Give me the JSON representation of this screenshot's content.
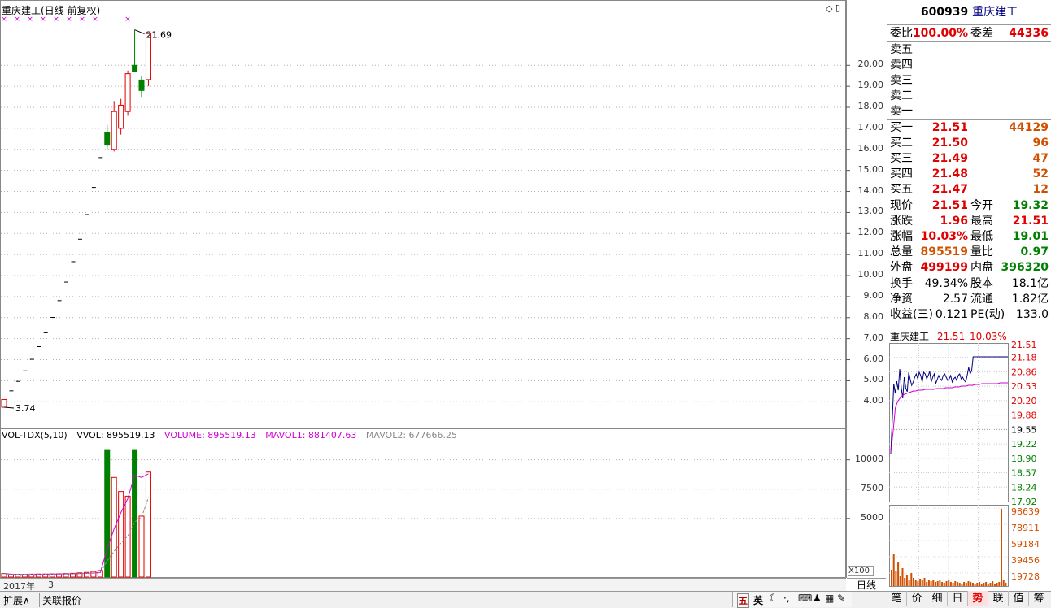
{
  "chart_title": "重庆建工(日线 前复权)",
  "price_axis": [
    "20.00",
    "19.00",
    "18.00",
    "17.00",
    "16.00",
    "15.00",
    "14.00",
    "13.00",
    "12.00",
    "11.00",
    "10.00",
    "9.00",
    "8.00",
    "7.00",
    "6.00",
    "5.00",
    "4.00"
  ],
  "vol_axis": [
    "10000",
    "7500",
    "5000"
  ],
  "vol_unit": "X100",
  "max_label": "21.69",
  "min_label": "3.74",
  "vol_legend": {
    "name": "VOL-TDX(5,10)",
    "vvol": "VVOL: 895519.13",
    "volume": "VOLUME: 895519.13",
    "mavol1": "MAVOL1: 881407.63",
    "mavol2": "MAVOL2: 677666.25"
  },
  "year_bar": {
    "year": "2017年",
    "month": "3"
  },
  "period_label": "日线",
  "bottom_tabs": [
    "扩展∧",
    "关联报价"
  ],
  "toolbar_icons": [
    "五",
    "英",
    "moon-icon",
    "dot-icon",
    "keyboard-icon",
    "users-icon",
    "grid-icon",
    "sound-icon",
    "wrench-icon"
  ],
  "quote": {
    "code": "600939",
    "name": "重庆建工",
    "weibi_label": "委比",
    "weibi": "100.00%",
    "weicha_label": "委差",
    "weicha": "44336",
    "sell": [
      {
        "label": "卖五",
        "price": "",
        "vol": ""
      },
      {
        "label": "卖四",
        "price": "",
        "vol": ""
      },
      {
        "label": "卖三",
        "price": "",
        "vol": ""
      },
      {
        "label": "卖二",
        "price": "",
        "vol": ""
      },
      {
        "label": "卖一",
        "price": "",
        "vol": ""
      }
    ],
    "buy": [
      {
        "label": "买一",
        "price": "21.51",
        "vol": "44129"
      },
      {
        "label": "买二",
        "price": "21.50",
        "vol": "96"
      },
      {
        "label": "买三",
        "price": "21.49",
        "vol": "47"
      },
      {
        "label": "买四",
        "price": "21.48",
        "vol": "52"
      },
      {
        "label": "买五",
        "price": "21.47",
        "vol": "12"
      }
    ],
    "stats1": [
      {
        "l1": "现价",
        "v1": "21.51",
        "c1": "red",
        "l2": "今开",
        "v2": "19.32",
        "c2": "green"
      },
      {
        "l1": "涨跌",
        "v1": "1.96",
        "c1": "red",
        "l2": "最高",
        "v2": "21.51",
        "c2": "red"
      },
      {
        "l1": "涨幅",
        "v1": "10.03%",
        "c1": "red",
        "l2": "最低",
        "v2": "19.01",
        "c2": "green"
      },
      {
        "l1": "总量",
        "v1": "895519",
        "c1": "orange",
        "l2": "量比",
        "v2": "0.97",
        "c2": "green"
      },
      {
        "l1": "外盘",
        "v1": "499199",
        "c1": "red",
        "l2": "内盘",
        "v2": "396320",
        "c2": "green"
      }
    ],
    "stats2": [
      {
        "l1": "换手",
        "v1": "49.34%",
        "l2": "股本",
        "v2": "18.1亿"
      },
      {
        "l1": "净资",
        "v1": "2.57",
        "l2": "流通",
        "v2": "1.82亿"
      },
      {
        "l1": "收益(三)",
        "v1": "0.121",
        "l2": "PE(动)",
        "v2": "133.0"
      }
    ]
  },
  "intraday": {
    "name": "重庆建工",
    "price": "21.51",
    "pct": "10.03%",
    "price_ticks": [
      "21.51",
      "21.18",
      "20.86",
      "20.53",
      "20.20",
      "19.88",
      "19.55",
      "19.22",
      "18.90",
      "18.57",
      "18.24",
      "17.92"
    ],
    "vol_ticks": [
      "98639",
      "78911",
      "59184",
      "39456",
      "19728"
    ]
  },
  "right_tabs": [
    "笔",
    "价",
    "细",
    "日",
    "势",
    "联",
    "值",
    "筹"
  ],
  "active_right_tab": "势",
  "chart_data": {
    "type": "candlestick",
    "title": "重庆建工(日线 前复权)",
    "price_range": [
      3.2,
      22.6
    ],
    "candles": [
      {
        "o": 3.74,
        "c": 4.11,
        "h": 4.11,
        "l": 3.74
      },
      {
        "o": 4.52,
        "c": 4.52,
        "h": 4.52,
        "l": 4.52
      },
      {
        "o": 4.97,
        "c": 4.97,
        "h": 4.97,
        "l": 4.97
      },
      {
        "o": 5.47,
        "c": 5.47,
        "h": 5.47,
        "l": 5.47
      },
      {
        "o": 6.02,
        "c": 6.02,
        "h": 6.02,
        "l": 6.02
      },
      {
        "o": 6.62,
        "c": 6.62,
        "h": 6.62,
        "l": 6.62
      },
      {
        "o": 7.28,
        "c": 7.28,
        "h": 7.28,
        "l": 7.28
      },
      {
        "o": 8.01,
        "c": 8.01,
        "h": 8.01,
        "l": 8.01
      },
      {
        "o": 8.81,
        "c": 8.81,
        "h": 8.81,
        "l": 8.81
      },
      {
        "o": 9.69,
        "c": 9.69,
        "h": 9.69,
        "l": 9.69
      },
      {
        "o": 10.66,
        "c": 10.66,
        "h": 10.66,
        "l": 10.66
      },
      {
        "o": 11.73,
        "c": 11.73,
        "h": 11.73,
        "l": 11.73
      },
      {
        "o": 12.9,
        "c": 12.9,
        "h": 12.9,
        "l": 12.9
      },
      {
        "o": 14.19,
        "c": 14.19,
        "h": 14.19,
        "l": 14.19
      },
      {
        "o": 15.61,
        "c": 15.61,
        "h": 15.61,
        "l": 15.61
      },
      {
        "o": 16.8,
        "c": 16.2,
        "h": 17.17,
        "l": 16.0
      },
      {
        "o": 16.0,
        "c": 17.8,
        "h": 18.3,
        "l": 15.9
      },
      {
        "o": 17.0,
        "c": 18.1,
        "h": 18.4,
        "l": 16.7
      },
      {
        "o": 17.8,
        "c": 19.6,
        "h": 19.75,
        "l": 17.6
      },
      {
        "o": 20.0,
        "c": 19.7,
        "h": 21.69,
        "l": 19.7
      },
      {
        "o": 19.3,
        "c": 18.8,
        "h": 19.5,
        "l": 18.5
      },
      {
        "o": 19.32,
        "c": 21.51,
        "h": 21.51,
        "l": 19.01
      }
    ],
    "volume": [
      300,
      200,
      220,
      240,
      250,
      260,
      260,
      270,
      280,
      300,
      320,
      360,
      400,
      480,
      560,
      10800,
      8500,
      7300,
      6900,
      10800,
      5200,
      8955
    ],
    "volume_up": [
      true,
      true,
      true,
      true,
      true,
      true,
      true,
      true,
      true,
      true,
      true,
      true,
      true,
      true,
      true,
      false,
      true,
      true,
      true,
      false,
      true,
      true
    ],
    "mavol1": [
      300,
      250,
      240,
      240,
      242,
      244,
      246,
      250,
      256,
      266,
      280,
      300,
      320,
      350,
      390,
      2400,
      4100,
      5500,
      6700,
      8700,
      8500,
      8814
    ],
    "mavol2": [
      300,
      250,
      240,
      240,
      242,
      244,
      246,
      250,
      256,
      266,
      280,
      300,
      320,
      340,
      370,
      1380,
      2200,
      2900,
      3500,
      4700,
      5100,
      6776
    ]
  }
}
